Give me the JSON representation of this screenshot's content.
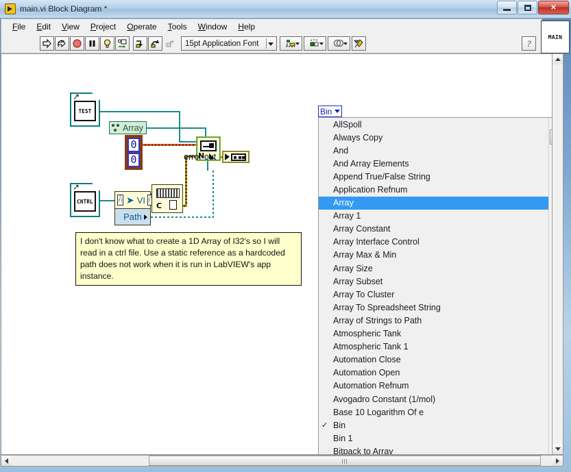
{
  "window": {
    "title": "main.vi Block Diagram *",
    "icon": "labview-vi-icon",
    "minimize_label": "",
    "maximize_label": "",
    "close_label": "✕"
  },
  "menubar": {
    "items": [
      {
        "label": "File",
        "mnemonic": "F"
      },
      {
        "label": "Edit",
        "mnemonic": "E"
      },
      {
        "label": "View",
        "mnemonic": "V"
      },
      {
        "label": "Project",
        "mnemonic": "P"
      },
      {
        "label": "Operate",
        "mnemonic": "O"
      },
      {
        "label": "Tools",
        "mnemonic": "T"
      },
      {
        "label": "Window",
        "mnemonic": "W"
      },
      {
        "label": "Help",
        "mnemonic": "H"
      }
    ]
  },
  "toolbar": {
    "run_label": "",
    "run_continuous_label": "",
    "abort_label": "",
    "pause_label": "",
    "highlight_label": "",
    "retain_values_label": "",
    "step_into_label": "",
    "step_over_label": "",
    "step_out_label": "",
    "font_selector_value": "15pt Application Font",
    "align_objects_label": "",
    "distribute_objects_label": "",
    "reorder_label": "",
    "cleanup_diagram_label": "",
    "help_label": "?",
    "context_button_label": "MAIN"
  },
  "diagram": {
    "nodes": {
      "test_ref_label": "TEST",
      "cntrl_ref_label": "CNTRL",
      "array_label": "Array",
      "array_constant_values": [
        "0",
        "0"
      ],
      "main_node_n_label": "N",
      "error_out_label": "error out",
      "property_node_label": "VI",
      "property_node_property": "Path",
      "file_node_label": "C"
    },
    "comment": "I don't know what to create a 1D Array of I32's so I will read in a ctrl file. Use a static reference as a hardcoded path does not work when it is run in LabVIEW's app instance."
  },
  "combo": {
    "value": "Bin"
  },
  "dropdown": {
    "selected": "Array",
    "checked": "Bin",
    "items": [
      "AllSpoll",
      "Always Copy",
      "And",
      "And Array Elements",
      "Append True/False String",
      "Application Refnum",
      "Array",
      "Array 1",
      "Array Constant",
      "Array Interface Control",
      "Array Max & Min",
      "Array Size",
      "Array Subset",
      "Array To Cluster",
      "Array To Spreadsheet String",
      "Array of Strings to Path",
      "Atmospheric Tank",
      "Atmospheric Tank 1",
      "Automation Close",
      "Automation Open",
      "Automation Refnum",
      "Avogadro Constant (1/mol)",
      "Base 10 Logarithm Of e",
      "Bin",
      "Bin 1",
      "Bitpack to Array"
    ]
  },
  "colors": {
    "selection_blue": "#3399f3",
    "wire_teal": "#1a8a8a",
    "error_wire": "#b58b00",
    "array_wire": "#8a3b10",
    "comment_bg": "#ffffcc",
    "node_yellow": "#fffbd8"
  }
}
